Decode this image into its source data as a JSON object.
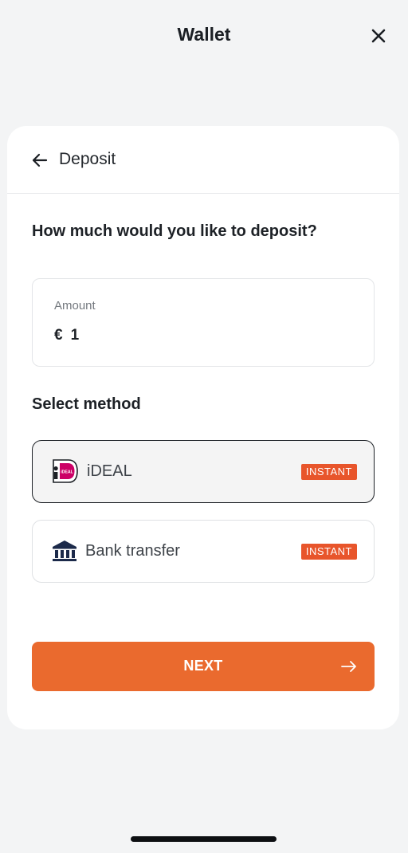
{
  "topbar": {
    "title": "Wallet",
    "close_icon": "close-icon"
  },
  "header": {
    "title": "Deposit",
    "back_icon": "arrow-left-icon"
  },
  "question": "How much would you like to deposit?",
  "amount": {
    "label": "Amount",
    "currency": "€",
    "value": "1"
  },
  "methods": {
    "title": "Select method",
    "items": [
      {
        "label": "iDEAL",
        "badge": "INSTANT",
        "icon": "ideal-logo-icon",
        "selected": true
      },
      {
        "label": "Bank transfer",
        "badge": "INSTANT",
        "icon": "bank-icon",
        "selected": false
      }
    ]
  },
  "next_button": {
    "label": "NEXT",
    "icon": "arrow-right-icon"
  },
  "colors": {
    "accent": "#ea6a2e",
    "badge": "#e8552b",
    "background": "#f3f4f5",
    "card": "#ffffff",
    "text": "#1b1f24",
    "ideal_pink": "#cc0066",
    "bank_navy": "#1c2a4a"
  }
}
